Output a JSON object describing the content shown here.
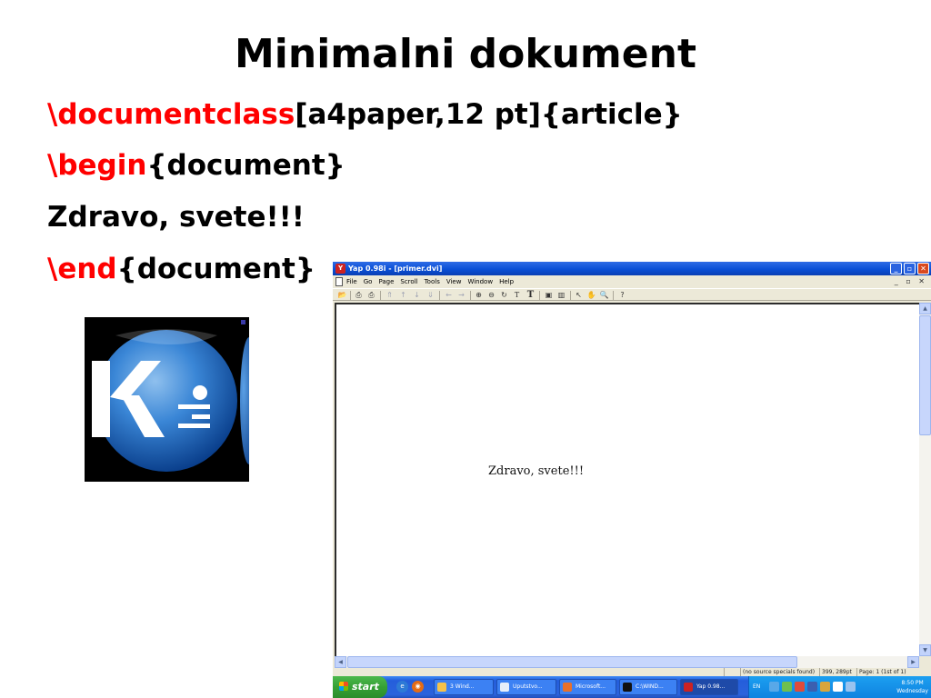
{
  "slide": {
    "title": "Minimalni dokument",
    "lines": [
      {
        "slash": "\\",
        "keyword": "documentclass",
        "rest": "[a4paper,12 pt]{article}"
      },
      {
        "slash": "\\",
        "keyword": "begin",
        "rest": "{document}"
      },
      {
        "text": "Zdravo, svete!!!"
      },
      {
        "slash": "\\",
        "keyword": "end",
        "rest": "{document}"
      }
    ]
  },
  "colors": {
    "keyword": "#ff0000",
    "window_title": "#0a4fd6",
    "taskbar": "#245edb",
    "start_button": "#35a035"
  },
  "logo": {
    "icon": "kile-logo-icon",
    "letter": "K"
  },
  "yap": {
    "title": "Yap 0.98i - [primer.dvi]",
    "menus": [
      "File",
      "Go",
      "Page",
      "Scroll",
      "Tools",
      "View",
      "Window",
      "Help"
    ],
    "document_text": "Zdravo, svete!!!",
    "status": {
      "specials": "(no source specials found)",
      "position": "399, 289pt",
      "page": "Page: 1 (1st of 1)"
    }
  },
  "taskbar": {
    "start_label": "start",
    "tasks": [
      {
        "label": "3 Wind...",
        "icon": "folder-icon"
      },
      {
        "label": "Uputstvo...",
        "icon": "word-doc-icon"
      },
      {
        "label": "Microsoft...",
        "icon": "powerpoint-icon"
      },
      {
        "label": "C:\\WIND...",
        "icon": "console-icon"
      },
      {
        "label": "Yap 0.98...",
        "icon": "yap-icon"
      }
    ],
    "language": "EN",
    "clock_time": "8:50 PM",
    "clock_day": "Wednesday"
  }
}
